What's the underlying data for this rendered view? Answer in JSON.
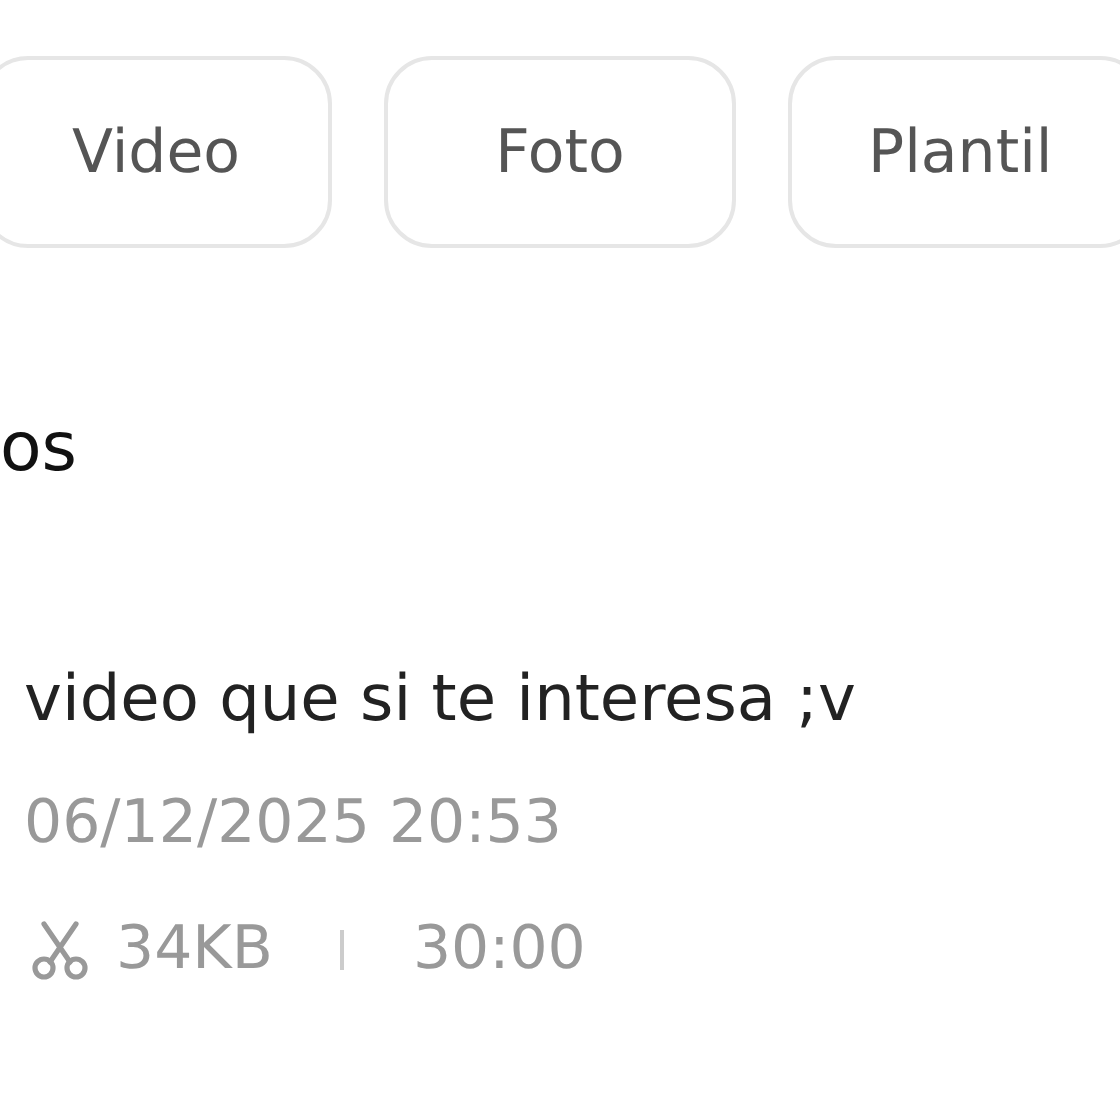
{
  "tabs": [
    {
      "label": "Video"
    },
    {
      "label": "Foto"
    },
    {
      "label": "Plantil"
    }
  ],
  "section_title": "os",
  "item": {
    "title": "video que si te interesa ;v",
    "date": "06/12/2025 20:53",
    "size": "34KB",
    "duration": "30:00"
  }
}
